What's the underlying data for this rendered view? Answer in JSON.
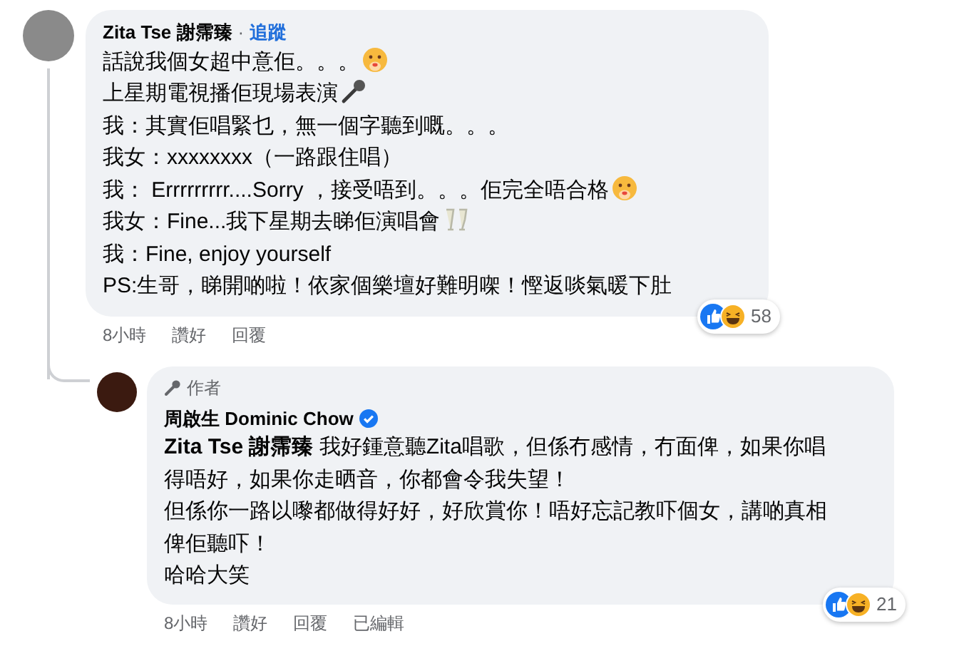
{
  "comment": {
    "author": "Zita Tse 謝霈臻",
    "separator": "·",
    "follow": "追蹤",
    "lines": [
      {
        "text": "話說我個女超中意佢。。。",
        "kind": "surprised"
      },
      {
        "text": "上星期電視播佢現場表演",
        "kind": "microphone"
      },
      {
        "text": "我：其實佢唱緊乜，無一個字聽到嘅。。。",
        "kind": "plain"
      },
      {
        "text": "我女：xxxxxxxx（一路跟住唱）",
        "kind": "plain"
      },
      {
        "text": "我： Errrrrrrrr....Sorry ，接受唔到。。。佢完全唔合格",
        "kind": "surprised"
      },
      {
        "text": "我女：Fine...我下星期去睇佢演唱會",
        "kind": "toast"
      },
      {
        "text": "我：Fine, enjoy yourself",
        "kind": "plain"
      },
      {
        "text": "PS:生哥，睇開啲啦！依家個樂壇好難明㗎！慳返啖氣暖下肚",
        "kind": "plain"
      }
    ],
    "time": "8小時",
    "actions": [
      "讚好",
      "回覆"
    ],
    "reaction_count": "58",
    "reply": {
      "badge": "作者",
      "author": "周啟生 Dominic Chow",
      "verified": true,
      "lines": [
        "**Zita Tse 謝霈臻** 我好鍾意聽Zita唱歌，但係冇感情，冇面俾，如果你唱得唔好，如果你走晒音，你都會令我失望！",
        "但係你一路以嚟都做得好好，好欣賞你！唔好忘記教吓個女，講啲真相俾佢聽吓！",
        "哈哈大笑"
      ],
      "time": "8小時",
      "actions": [
        "讚好",
        "回覆"
      ],
      "edited": "已編輯",
      "reaction_count": "21"
    }
  }
}
